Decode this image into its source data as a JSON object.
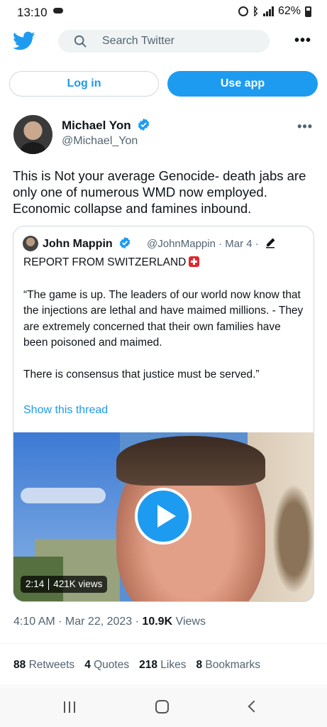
{
  "status_bar": {
    "time": "13:10",
    "battery": "62%"
  },
  "header": {
    "search_placeholder": "Search Twitter"
  },
  "auth": {
    "login_label": "Log in",
    "use_app_label": "Use app"
  },
  "tweet": {
    "author_name": "Michael Yon",
    "author_handle": "@Michael_Yon",
    "text": "This is Not your average Genocide- death jabs are only one of numerous WMD now employed. Economic collapse and famines inbound.",
    "timestamp": "4:10 AM · Mar 22, 2023 · ",
    "views_count": "10.9K",
    "views_label": " Views",
    "stats": {
      "retweets_count": "88",
      "retweets_label": "Retweets",
      "quotes_count": "4",
      "quotes_label": "Quotes",
      "likes_count": "218",
      "likes_label": "Likes",
      "bookmarks_count": "8",
      "bookmarks_label": "Bookmarks"
    }
  },
  "quote": {
    "author_name": "John Mappin",
    "author_handle": "@JohnMappin · Mar 4 ·",
    "title": "REPORT FROM SWITZERLAND",
    "para1": "“The game is up. The leaders of our world now know that the injections are lethal and have maimed millions.  -  They are extremely concerned that their own families have been poisoned and maimed.",
    "para2": "There is consensus that justice must be served.”",
    "show_thread": "Show this thread",
    "video": {
      "duration": "2:14",
      "views": "421K views"
    }
  },
  "colors": {
    "accent": "#1d9bf0",
    "text_primary": "#0f1419",
    "text_secondary": "#536471"
  }
}
